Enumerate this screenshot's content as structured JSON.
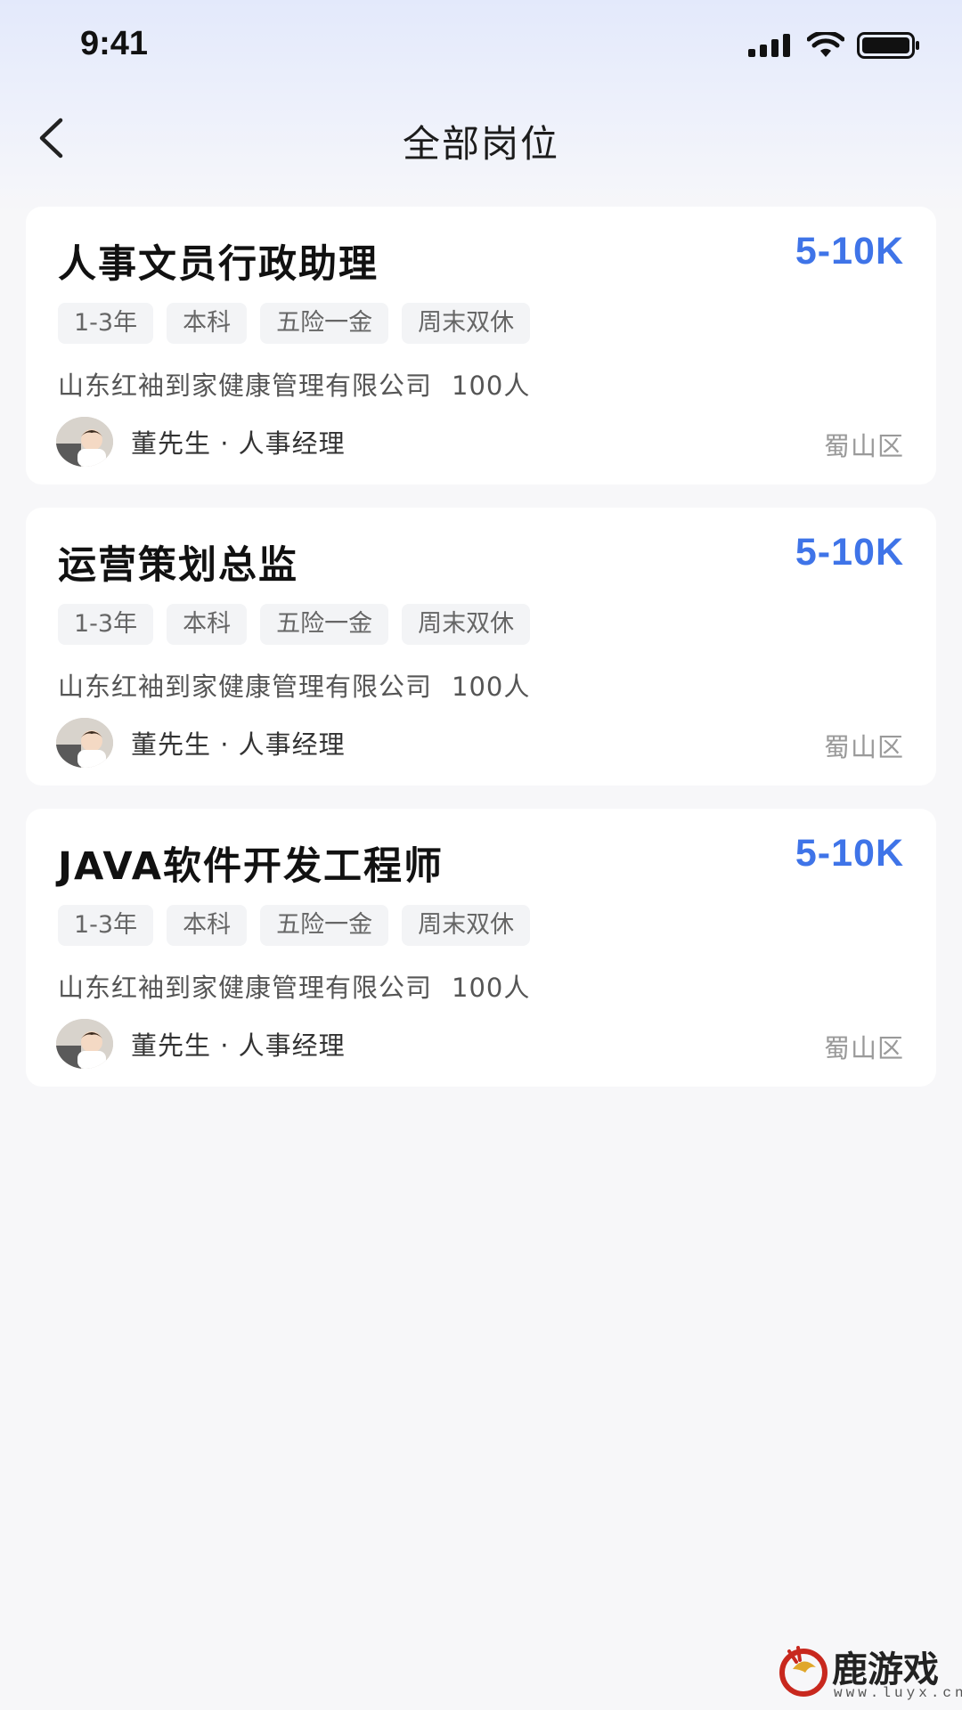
{
  "status_bar": {
    "time": "9:41",
    "icons": [
      "signal-icon",
      "wifi-icon",
      "battery-icon"
    ]
  },
  "header": {
    "back_icon": "chevron-left-icon",
    "title": "全部岗位"
  },
  "colors": {
    "accent": "#3f74e8",
    "background": "#f7f7f9",
    "card": "#ffffff",
    "tag_bg": "#f3f4f6"
  },
  "jobs": [
    {
      "title": "人事文员行政助理",
      "salary": "5-10K",
      "tags": [
        "1-3年",
        "本科",
        "五险一金",
        "周末双休"
      ],
      "company": "山东红袖到家健康管理有限公司",
      "company_size": "100人",
      "recruiter": "董先生 · 人事经理",
      "district": "蜀山区"
    },
    {
      "title": "运营策划总监",
      "salary": "5-10K",
      "tags": [
        "1-3年",
        "本科",
        "五险一金",
        "周末双休"
      ],
      "company": "山东红袖到家健康管理有限公司",
      "company_size": "100人",
      "recruiter": "董先生 · 人事经理",
      "district": "蜀山区"
    },
    {
      "title": "JAVA软件开发工程师",
      "salary": "5-10K",
      "tags": [
        "1-3年",
        "本科",
        "五险一金",
        "周末双休"
      ],
      "company": "山东红袖到家健康管理有限公司",
      "company_size": "100人",
      "recruiter": "董先生 · 人事经理",
      "district": "蜀山区"
    }
  ],
  "watermark": {
    "name": "鹿游戏",
    "url": "www.luyx.cn"
  }
}
